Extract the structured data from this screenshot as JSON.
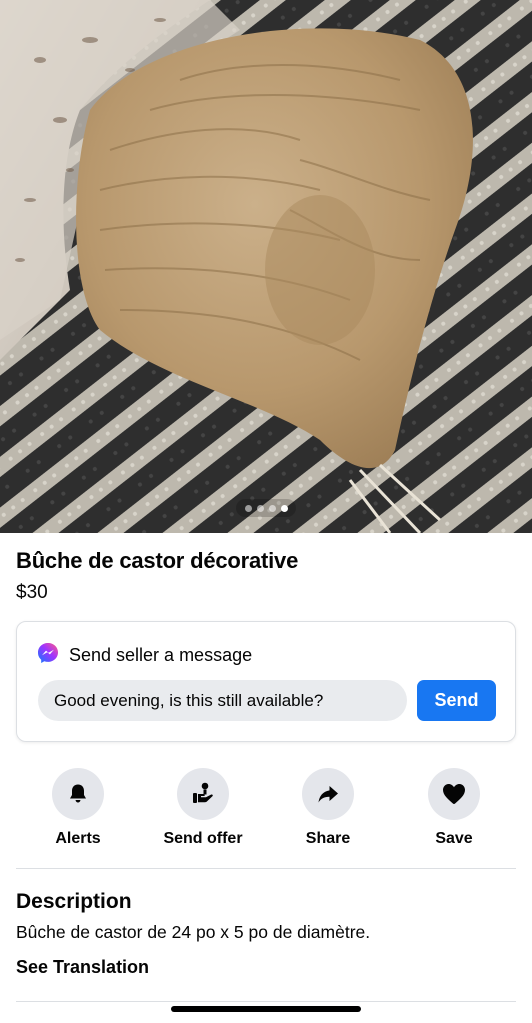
{
  "listing": {
    "title": "Bûche de castor décorative",
    "price": "$30",
    "photo": {
      "subject": "beaver-chewed-log",
      "total": 4,
      "current": 4
    }
  },
  "message": {
    "header": "Send seller a message",
    "input_value": "Good evening, is this still available?",
    "send_label": "Send",
    "icon": "messenger-icon",
    "accent": "#1877f2"
  },
  "actions": [
    {
      "label": "Alerts",
      "icon": "bell-icon"
    },
    {
      "label": "Send offer",
      "icon": "offer-icon"
    },
    {
      "label": "Share",
      "icon": "share-icon"
    },
    {
      "label": "Save",
      "icon": "heart-icon"
    }
  ],
  "description": {
    "heading": "Description",
    "text": "Bûche de castor de 24 po x 5 po de diamètre.",
    "translate_label": "See Translation"
  }
}
